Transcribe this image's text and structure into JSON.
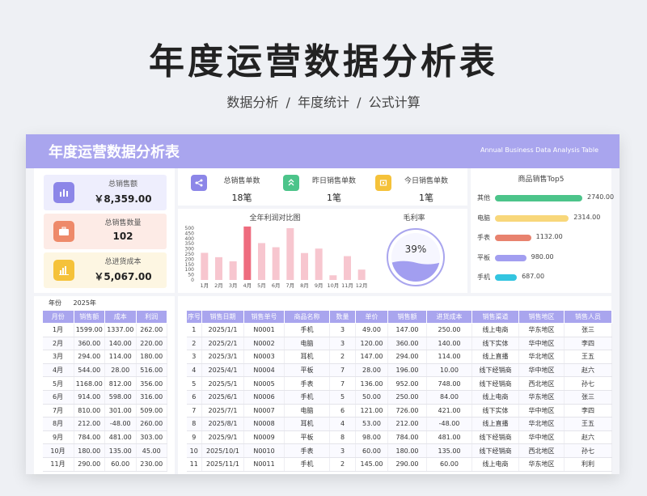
{
  "hero": {
    "title": "年度运营数据分析表",
    "subtitle": [
      "数据分析",
      "/",
      "年度统计",
      "/",
      "公式计算"
    ]
  },
  "banner": {
    "title": "年度运营数据分析表",
    "english": "Annual Business Data Analysis Table"
  },
  "kpis": [
    {
      "label": "总销售额",
      "value": "￥8,359.00",
      "icon": "bar-chart-icon",
      "color": "#8c86e8",
      "bg": "#eeeefd"
    },
    {
      "label": "总销售数量",
      "value": "102",
      "icon": "briefcase-icon",
      "color": "#ee8a6a",
      "bg": "#fdebe6"
    },
    {
      "label": "总进货成本",
      "value": "￥5,067.00",
      "icon": "column-chart-icon",
      "color": "#f5c23a",
      "bg": "#fdf6e2"
    }
  ],
  "stats": [
    {
      "label": "总销售单数",
      "value": "18笔",
      "icon": "share-icon",
      "color": "#8c86e8"
    },
    {
      "label": "昨日销售单数",
      "value": "1笔",
      "icon": "chevrons-icon",
      "color": "#4cc48a"
    },
    {
      "label": "今日销售单数",
      "value": "1笔",
      "icon": "box-icon",
      "color": "#f5c23a"
    }
  ],
  "profit_chart_title": "全年利润对比图",
  "margin_title": "毛利率",
  "margin_value": "39%",
  "top5_title": "商品销售Top5",
  "chart_data": [
    {
      "type": "bar",
      "title": "全年利润对比图",
      "categories": [
        "1月",
        "2月",
        "3月",
        "4月",
        "5月",
        "6月",
        "7月",
        "8月",
        "9月",
        "10月",
        "11月",
        "12月"
      ],
      "values": [
        262,
        220,
        180,
        516,
        356,
        316,
        500,
        260,
        303,
        45,
        230,
        100
      ],
      "highlight_index": 3,
      "yticks": [
        "0",
        "50",
        "100",
        "150",
        "200",
        "250",
        "300",
        "350",
        "400",
        "450",
        "500"
      ],
      "ylim": [
        0,
        500
      ],
      "colors": {
        "normal": "#f7c6cf",
        "highlight": "#ee6c7e"
      }
    },
    {
      "type": "bar",
      "title": "商品销售Top5",
      "categories": [
        "其他",
        "电脑",
        "手表",
        "平板",
        "手机"
      ],
      "values": [
        2740.0,
        2314.0,
        1132.0,
        980.0,
        687.0
      ],
      "labels": [
        "2740.00",
        "2314.00",
        "1132.00",
        "980.00",
        "687.00"
      ],
      "colors": [
        "#4cc48a",
        "#f8d77a",
        "#e8826e",
        "#a29ef0",
        "#33c5e0"
      ]
    }
  ],
  "year": {
    "label": "年份",
    "value": "2025年"
  },
  "month_table": {
    "headers": [
      "月份",
      "销售额",
      "成本",
      "利润"
    ],
    "rows": [
      [
        "1月",
        "1599.00",
        "1337.00",
        "262.00"
      ],
      [
        "2月",
        "360.00",
        "140.00",
        "220.00"
      ],
      [
        "3月",
        "294.00",
        "114.00",
        "180.00"
      ],
      [
        "4月",
        "544.00",
        "28.00",
        "516.00"
      ],
      [
        "5月",
        "1168.00",
        "812.00",
        "356.00"
      ],
      [
        "6月",
        "914.00",
        "598.00",
        "316.00"
      ],
      [
        "7月",
        "810.00",
        "301.00",
        "509.00"
      ],
      [
        "8月",
        "212.00",
        "-48.00",
        "260.00"
      ],
      [
        "9月",
        "784.00",
        "481.00",
        "303.00"
      ],
      [
        "10月",
        "180.00",
        "135.00",
        "45.00"
      ],
      [
        "11月",
        "290.00",
        "60.00",
        "230.00"
      ]
    ]
  },
  "detail_table": {
    "headers": [
      "序号",
      "销售日期",
      "销售单号",
      "商品名称",
      "数量",
      "单价",
      "销售额",
      "进货成本",
      "销售渠道",
      "销售地区",
      "销售人员"
    ],
    "rows": [
      [
        "1",
        "2025/1/1",
        "N0001",
        "手机",
        "3",
        "49.00",
        "147.00",
        "250.00",
        "线上电商",
        "华东地区",
        "张三"
      ],
      [
        "2",
        "2025/2/1",
        "N0002",
        "电脑",
        "3",
        "120.00",
        "360.00",
        "140.00",
        "线下实体",
        "华中地区",
        "李四"
      ],
      [
        "3",
        "2025/3/1",
        "N0003",
        "耳机",
        "2",
        "147.00",
        "294.00",
        "114.00",
        "线上直播",
        "华北地区",
        "王五"
      ],
      [
        "4",
        "2025/4/1",
        "N0004",
        "平板",
        "7",
        "28.00",
        "196.00",
        "10.00",
        "线下经销商",
        "华中地区",
        "赵六"
      ],
      [
        "5",
        "2025/5/1",
        "N0005",
        "手表",
        "7",
        "136.00",
        "952.00",
        "748.00",
        "线下经销商",
        "西北地区",
        "孙七"
      ],
      [
        "6",
        "2025/6/1",
        "N0006",
        "手机",
        "5",
        "50.00",
        "250.00",
        "84.00",
        "线上电商",
        "华东地区",
        "张三"
      ],
      [
        "7",
        "2025/7/1",
        "N0007",
        "电脑",
        "6",
        "121.00",
        "726.00",
        "421.00",
        "线下实体",
        "华中地区",
        "李四"
      ],
      [
        "8",
        "2025/8/1",
        "N0008",
        "耳机",
        "4",
        "53.00",
        "212.00",
        "-48.00",
        "线上直播",
        "华北地区",
        "王五"
      ],
      [
        "9",
        "2025/9/1",
        "N0009",
        "平板",
        "8",
        "98.00",
        "784.00",
        "481.00",
        "线下经销商",
        "华中地区",
        "赵六"
      ],
      [
        "10",
        "2025/10/1",
        "N0010",
        "手表",
        "3",
        "60.00",
        "180.00",
        "135.00",
        "线下经销商",
        "西北地区",
        "孙七"
      ],
      [
        "11",
        "2025/11/1",
        "N0011",
        "手机",
        "2",
        "145.00",
        "290.00",
        "60.00",
        "线上电商",
        "华东地区",
        "利利"
      ]
    ]
  }
}
